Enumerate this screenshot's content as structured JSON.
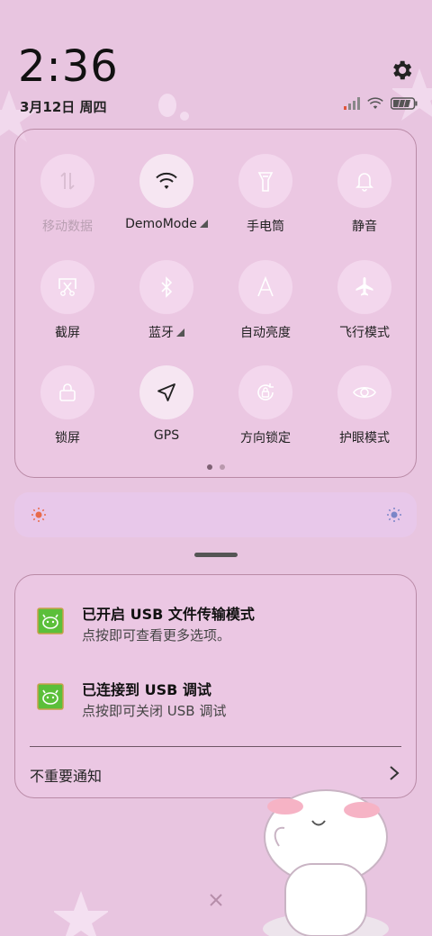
{
  "status_bar": {
    "time": "2:36",
    "date": "3月12日 周四"
  },
  "quick_settings": {
    "tiles": [
      {
        "label": "移动数据",
        "icon": "mobile-data-icon",
        "state": "disabled"
      },
      {
        "label": "DemoMode",
        "icon": "wifi-icon",
        "state": "active",
        "expandable": true
      },
      {
        "label": "手电筒",
        "icon": "flashlight-icon",
        "state": "off"
      },
      {
        "label": "静音",
        "icon": "bell-icon",
        "state": "off"
      },
      {
        "label": "截屏",
        "icon": "screenshot-icon",
        "state": "off"
      },
      {
        "label": "蓝牙",
        "icon": "bluetooth-icon",
        "state": "off",
        "expandable": true
      },
      {
        "label": "自动亮度",
        "icon": "auto-brightness-icon",
        "state": "off"
      },
      {
        "label": "飞行模式",
        "icon": "airplane-icon",
        "state": "off"
      },
      {
        "label": "锁屏",
        "icon": "lock-icon",
        "state": "off"
      },
      {
        "label": "GPS",
        "icon": "location-arrow-icon",
        "state": "active"
      },
      {
        "label": "方向锁定",
        "icon": "rotation-lock-icon",
        "state": "off"
      },
      {
        "label": "护眼模式",
        "icon": "eye-icon",
        "state": "off"
      }
    ],
    "page_indicator": {
      "pages": 2,
      "current": 1
    }
  },
  "notifications": [
    {
      "title": "已开启 USB 文件传输模式",
      "subtitle": "点按即可查看更多选项。",
      "icon": "android-app-icon"
    },
    {
      "title": "已连接到 USB 调试",
      "subtitle": "点按即可关闭 USB 调试",
      "icon": "android-app-icon"
    }
  ],
  "minor_notifications": {
    "label": "不重要通知"
  },
  "colors": {
    "background": "#e8c5e0",
    "panel_border": "#b98aa6",
    "brightness_bar": "#e8c8ea",
    "app_icon_green": "#5bbf3a"
  }
}
